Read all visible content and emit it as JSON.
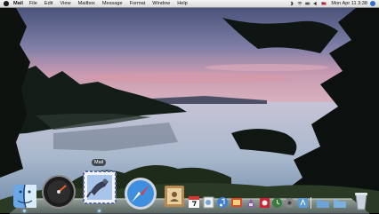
{
  "menubar": {
    "app_name": "Mail",
    "menus": [
      "File",
      "Edit",
      "View",
      "Mailbox",
      "Message",
      "Format",
      "Window",
      "Help"
    ],
    "clock": "Mon Apr 11  3:38",
    "status_icons": [
      "bluetooth-icon",
      "wifi-icon",
      "battery-icon",
      "volume-icon",
      "input-flag-icon"
    ]
  },
  "dock": {
    "tooltip": "Mail",
    "items": [
      "finder-icon",
      "dashboard-icon",
      "mail-icon",
      "safari-icon",
      "address-book-icon",
      "ical-icon",
      "preview-icon",
      "itunes-icon",
      "iphoto-icon",
      "imovie-icon",
      "system-preferences-icon",
      "trash-icon"
    ]
  },
  "colors": {
    "menubar": "#e4e4e4",
    "sky": "#7a7fa6",
    "water": "#a9b7c9"
  }
}
